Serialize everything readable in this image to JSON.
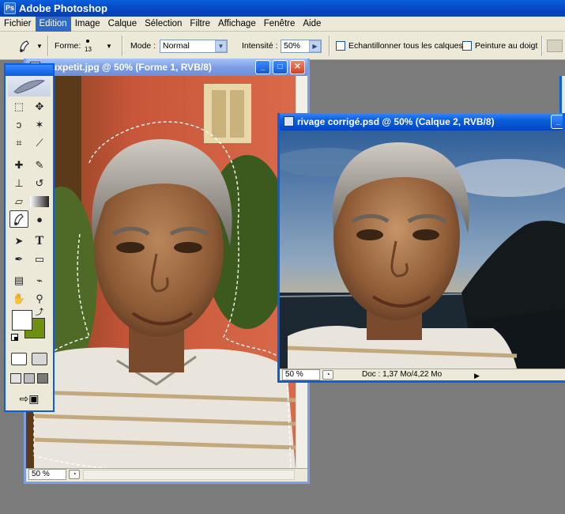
{
  "app": {
    "title": "Adobe Photoshop"
  },
  "menu": [
    "Fichier",
    "Edition",
    "Image",
    "Calque",
    "Sélection",
    "Filtre",
    "Affichage",
    "Fenêtre",
    "Aide"
  ],
  "menu_active": "Edition",
  "options": {
    "forme_label": "Forme:",
    "brush_size": "13",
    "mode_label": "Mode :",
    "mode_value": "Normal",
    "intensity_label": "Intensité :",
    "intensity_value": "50%",
    "sample_all_label": "Echantillonner tous les calques",
    "finger_paint_label": "Peinture au doigt"
  },
  "doc1": {
    "title": "ieuxpetit.jpg @ 50% (Forme 1, RVB/8)",
    "zoom": "50 %"
  },
  "doc2": {
    "title": "rivage corrigé.psd @ 50% (Calque 2, RVB/8)",
    "zoom": "50 %",
    "doc_info": "Doc : 1,37 Mo/4,22 Mo"
  },
  "window_buttons": {
    "minimize": "_",
    "maximize": "□",
    "close": "✕"
  },
  "colors": {
    "xp_blue": "#0a5fdc",
    "foreground_color": "#ffffff",
    "background_color": "#6f8f10"
  },
  "icons": {
    "smudge": "smudge-icon",
    "marquee": "marquee-icon",
    "move": "move-icon",
    "lasso": "lasso-icon",
    "magic_wand": "magic-wand-icon",
    "crop": "crop-icon",
    "slice": "slice-icon",
    "heal": "healing-brush-icon",
    "brush": "brush-icon",
    "stamp": "clone-stamp-icon",
    "history_brush": "history-brush-icon",
    "eraser": "eraser-icon",
    "gradient": "gradient-icon",
    "dodge": "dodge-icon",
    "path_select": "path-selection-icon",
    "type": "type-icon",
    "pen": "pen-icon",
    "shape": "shape-icon",
    "notes": "notes-icon",
    "eyedropper": "eyedropper-icon",
    "hand": "hand-icon",
    "zoom": "zoom-icon"
  }
}
